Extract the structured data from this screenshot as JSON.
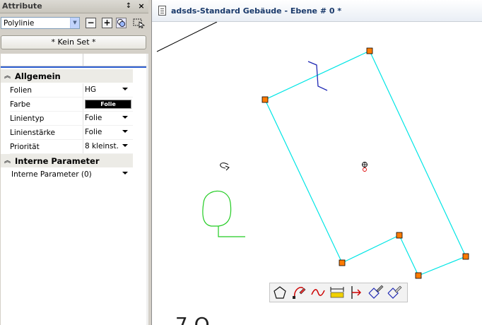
{
  "panel": {
    "title": "Attribute",
    "pin_glyph": "↕",
    "close_glyph": "×",
    "type_select": {
      "value": "Polylinie"
    },
    "toolbar": {
      "minus": "−",
      "plus": "+"
    },
    "set_button": "* Kein Set *"
  },
  "grid": {
    "sections": [
      {
        "label": "Allgemein",
        "rows": [
          {
            "name": "Folien",
            "value": "HG"
          },
          {
            "name": "Farbe",
            "value": "Folie"
          },
          {
            "name": "Linientyp",
            "value": "Folie"
          },
          {
            "name": "Linienstärke",
            "value": "Folie"
          },
          {
            "name": "Priorität",
            "value": "8 kleinst."
          }
        ]
      },
      {
        "label": "Interne Parameter",
        "rows": [
          {
            "name": "Interne Parameter (0)",
            "value": ""
          }
        ]
      }
    ]
  },
  "drawing": {
    "title": "adsds-Standard Gebäude - Ebene # 0 *",
    "bottom_fragment": "_ 7 Q",
    "colors": {
      "outline": "#00e5e5",
      "handle": "#ff7b00",
      "green_symbol": "#22cc22",
      "blue_mark": "#1e28b4"
    }
  },
  "palette": {
    "tools": [
      "polygon-icon",
      "bezier-icon",
      "wave-icon",
      "dimension-icon",
      "vertex-arrow-icon",
      "pen-diamond-icon",
      "pencil-diamond-icon"
    ]
  },
  "colors": {
    "panel_bg": "#d4d0c8",
    "accent": "#2e5fd1"
  }
}
